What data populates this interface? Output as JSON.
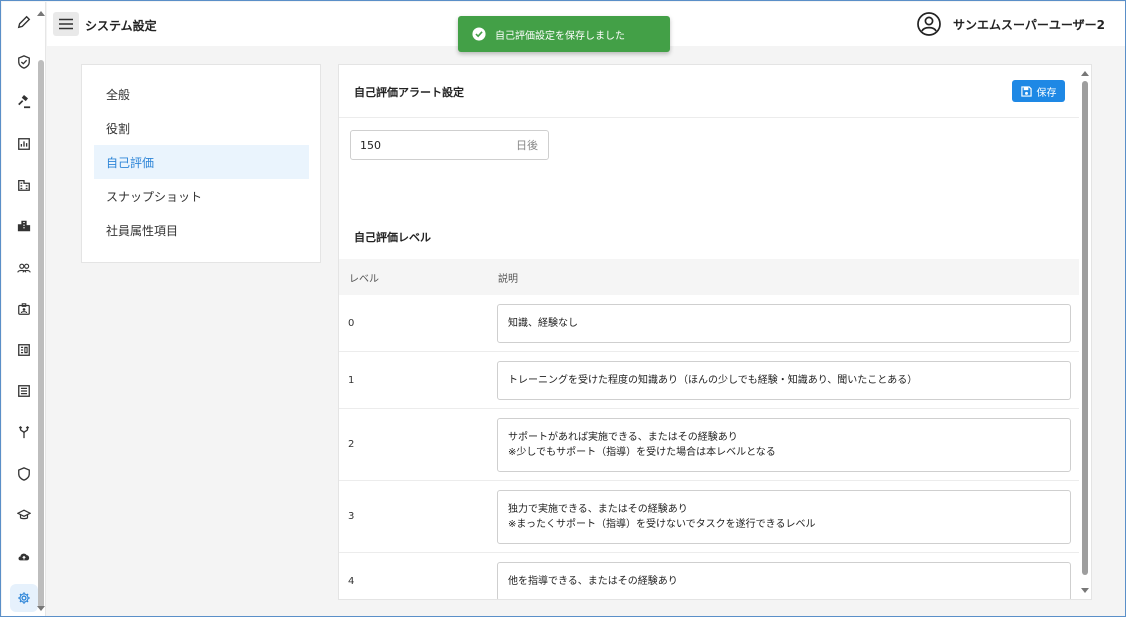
{
  "header": {
    "title": "システム設定",
    "user_name": "サンエムスーパーユーザー2"
  },
  "toast": {
    "message": "自己評価設定を保存しました",
    "color": "#43a047"
  },
  "rail": {
    "icons": [
      "pencil-icon",
      "shield-check-icon",
      "gavel-icon",
      "chart-icon",
      "building-icon",
      "buildings-icon",
      "people-icon",
      "id-badge-icon",
      "card-icon",
      "list-icon",
      "fork-icon",
      "shield-icon",
      "school-icon",
      "cloud-upload-icon",
      "gear-icon"
    ],
    "active": "gear-icon",
    "accent": "#2f86d8"
  },
  "nav": {
    "items": [
      {
        "label": "全般"
      },
      {
        "label": "役割"
      },
      {
        "label": "自己評価"
      },
      {
        "label": "スナップショット"
      },
      {
        "label": "社員属性項目"
      }
    ],
    "active_index": 2
  },
  "main": {
    "alert_title": "自己評価アラート設定",
    "save_label": "保存",
    "days_value": "150",
    "days_unit": "日後",
    "level_title": "自己評価レベル",
    "columns": [
      "レベル",
      "説明"
    ],
    "rows": [
      {
        "level": "0",
        "lines": [
          "知識、経験なし"
        ]
      },
      {
        "level": "1",
        "lines": [
          "トレーニングを受けた程度の知識あり（ほんの少しでも経験・知識あり、聞いたことある）"
        ]
      },
      {
        "level": "2",
        "lines": [
          "サポートがあれば実施できる、またはその経験あり",
          "※少しでもサポート（指導）を受けた場合は本レベルとなる"
        ]
      },
      {
        "level": "3",
        "lines": [
          "独力で実施できる、またはその経験あり",
          "※まったくサポート（指導）を受けないでタスクを遂行できるレベル"
        ]
      },
      {
        "level": "4",
        "lines": [
          "他を指導できる、またはその経験あり"
        ]
      }
    ]
  }
}
